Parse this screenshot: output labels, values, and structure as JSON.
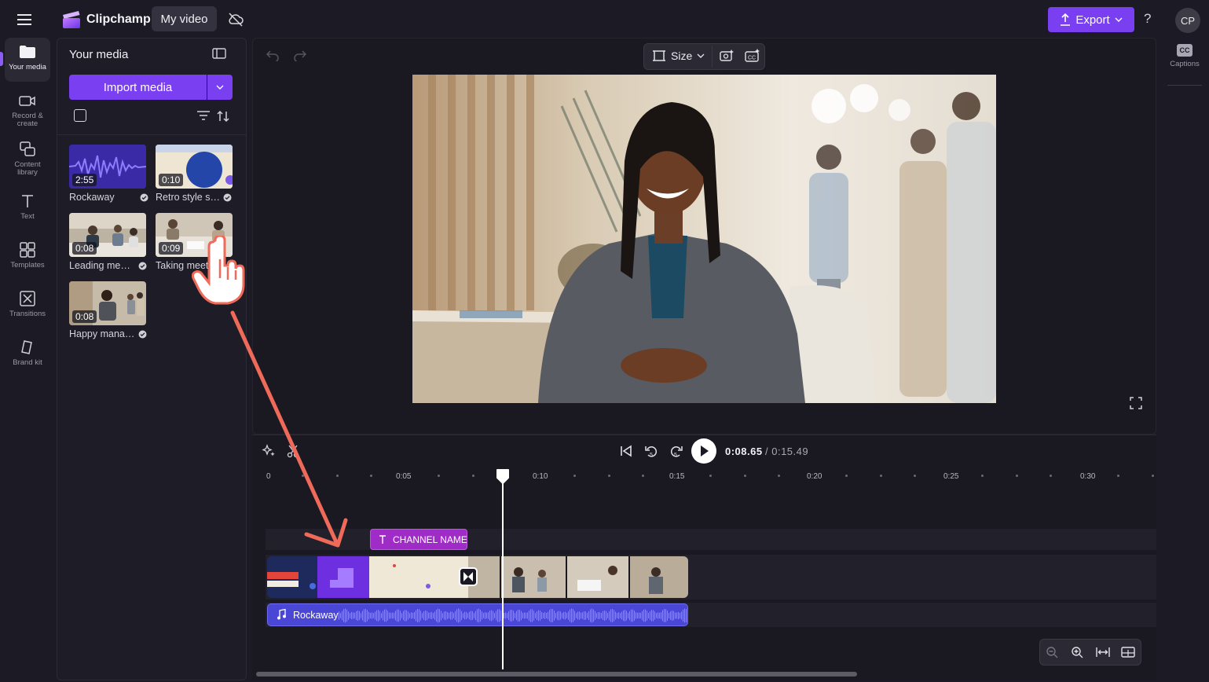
{
  "app": {
    "name": "Clipchamp",
    "project_title": "My video"
  },
  "header": {
    "export_label": "Export",
    "help_label": "?",
    "avatar_initials": "CP"
  },
  "rail": [
    {
      "label": "Your media"
    },
    {
      "label": "Record &\ncreate"
    },
    {
      "label": "Content\nlibrary"
    },
    {
      "label": "Text"
    },
    {
      "label": "Templates"
    },
    {
      "label": "Transitions"
    },
    {
      "label": "Brand kit"
    }
  ],
  "media_panel": {
    "title": "Your media",
    "import_label": "Import media",
    "items": [
      {
        "duration": "2:55",
        "name": "Rockaway"
      },
      {
        "duration": "0:10",
        "name": "Retro style sh..."
      },
      {
        "duration": "0:08",
        "name": "Leading meeti..."
      },
      {
        "duration": "0:09",
        "name": "Taking meeti"
      },
      {
        "duration": "0:08",
        "name": "Happy manag..."
      }
    ]
  },
  "preview": {
    "size_label": "Size"
  },
  "right_rail": {
    "captions_label": "Captions",
    "captions_badge": "CC"
  },
  "playback": {
    "current_time": "0:08.65",
    "total_time": "/ 0:15.49",
    "skip_back_seconds": "5",
    "skip_fwd_seconds": "5"
  },
  "ruler": {
    "labels": [
      "0",
      "0:05",
      "0:10",
      "0:15",
      "0:20",
      "0:25",
      "0:30"
    ]
  },
  "tracks": {
    "text_clip_label": "CHANNEL NAME",
    "audio_clip_label": "Rockaway"
  },
  "colors": {
    "accent": "#7b3ff2",
    "text_clip": "#a02cc7",
    "audio_clip": "#4a47d6",
    "arrow": "#f06a5a"
  },
  "icons": [
    "hamburger-icon",
    "cloud-off-icon",
    "upload-icon",
    "folder-icon",
    "camera-icon",
    "library-icon",
    "text-t-icon",
    "templates-icon",
    "transitions-icon",
    "brand-kit-icon",
    "undo-icon",
    "redo-icon",
    "crop-icon",
    "ai-icon",
    "magic-captions-icon",
    "fullscreen-icon",
    "sparkle-icon",
    "scissors-icon",
    "skip-start-icon",
    "rewind-5-icon",
    "forward-5-icon",
    "play-icon",
    "zoom-out-icon",
    "zoom-in-icon",
    "fit-icon",
    "expand-icon",
    "music-note-icon",
    "hand-cursor-icon"
  ]
}
